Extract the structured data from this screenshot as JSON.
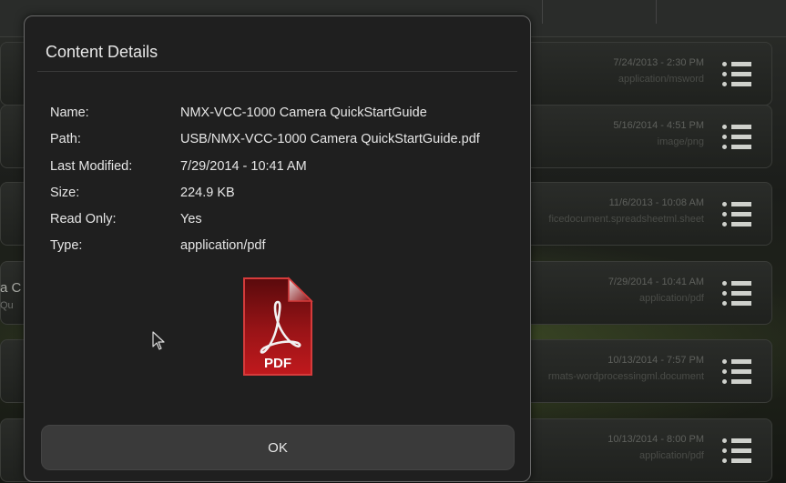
{
  "background": {
    "left_partial_title": "a C",
    "left_partial_sub": "Qu",
    "rows": [
      {
        "date": "7/24/2013 - 2:30 PM",
        "mime": "application/msword"
      },
      {
        "date": "5/16/2014 - 4:51 PM",
        "mime": "image/png"
      },
      {
        "date": "11/6/2013 - 10:08 AM",
        "mime": "ficedocument.spreadsheetml.sheet"
      },
      {
        "date": "7/29/2014 - 10:41 AM",
        "mime": "application/pdf"
      },
      {
        "date": "10/13/2014 - 7:57 PM",
        "mime": "rmats-wordprocessingml.document"
      },
      {
        "date": "10/13/2014 - 8:00 PM",
        "mime": "application/pdf"
      }
    ]
  },
  "dialog": {
    "title": "Content Details",
    "fields": [
      {
        "label": "Name:",
        "value": "NMX-VCC-1000 Camera QuickStartGuide"
      },
      {
        "label": "Path:",
        "value": "USB/NMX-VCC-1000 Camera QuickStartGuide.pdf"
      },
      {
        "label": "Last Modified:",
        "value": "7/29/2014 - 10:41 AM"
      },
      {
        "label": "Size:",
        "value": "224.9 KB"
      },
      {
        "label": "Read Only:",
        "value": "Yes"
      },
      {
        "label": "Type:",
        "value": "application/pdf"
      }
    ],
    "file_icon": {
      "name": "pdf-file-icon",
      "label": "PDF",
      "color": "#a3171b"
    },
    "ok_label": "OK"
  },
  "colors": {
    "dialog_bg": "#1f1f1f",
    "button_bg": "#3a3a3a",
    "text": "#e6e6e6",
    "pdf_red": "#a3171b"
  }
}
